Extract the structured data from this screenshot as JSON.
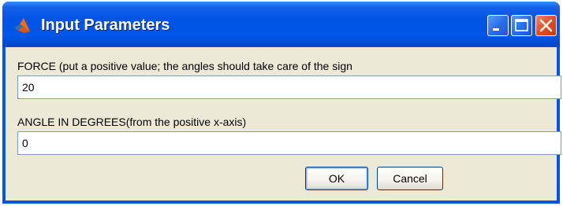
{
  "window": {
    "title": "Input Parameters",
    "app_icon": "matlab-logo-icon",
    "controls": [
      "minimize-icon",
      "maximize-icon",
      "close-icon"
    ]
  },
  "form": {
    "force_label": "FORCE (put a positive value; the angles should take care of the sign",
    "force_value": "20",
    "angle_label": "ANGLE IN DEGREES(from the positive x-axis)",
    "angle_value": "0"
  },
  "buttons": {
    "ok_label": "OK",
    "cancel_label": "Cancel"
  },
  "colors": {
    "titlebar": "#0054e3",
    "client_background": "#ece9d8",
    "close_button": "#e04e2a"
  }
}
